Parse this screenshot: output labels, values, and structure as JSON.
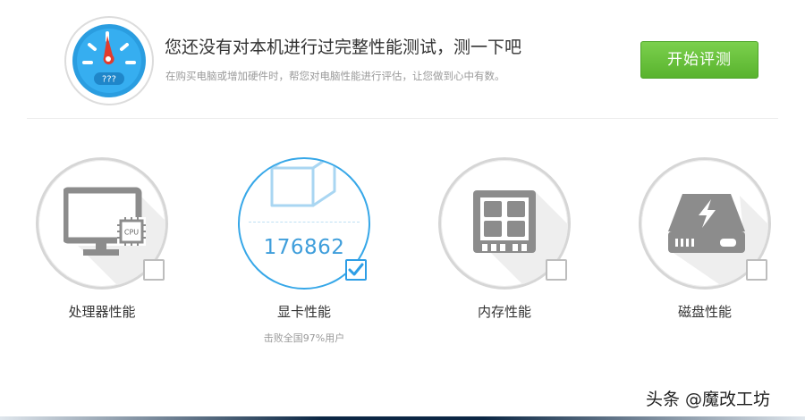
{
  "header": {
    "gauge_readout": "???",
    "headline": "您还没有对本机进行过完整性能测试，测一下吧",
    "subline": "在购买电脑或增加硬件时，帮您对电脑性能进行评估，让您做到心中有数。",
    "start_button": "开始评测"
  },
  "cards": [
    {
      "label": "处理器性能",
      "icon": "monitor-cpu-icon",
      "chip_text": "CPU",
      "checked": false
    },
    {
      "label": "显卡性能",
      "icon": "cube-wireframe-icon",
      "score": "176862",
      "note": "击败全国97%用户",
      "checked": true
    },
    {
      "label": "内存性能",
      "icon": "memory-chip-icon",
      "checked": false
    },
    {
      "label": "磁盘性能",
      "icon": "hard-disk-icon",
      "checked": false
    }
  ],
  "watermark": "头条 @魔改工坊",
  "colors": {
    "accent_blue": "#36a7e8",
    "button_green": "#67c23a",
    "icon_gray": "#8c8c8c"
  }
}
